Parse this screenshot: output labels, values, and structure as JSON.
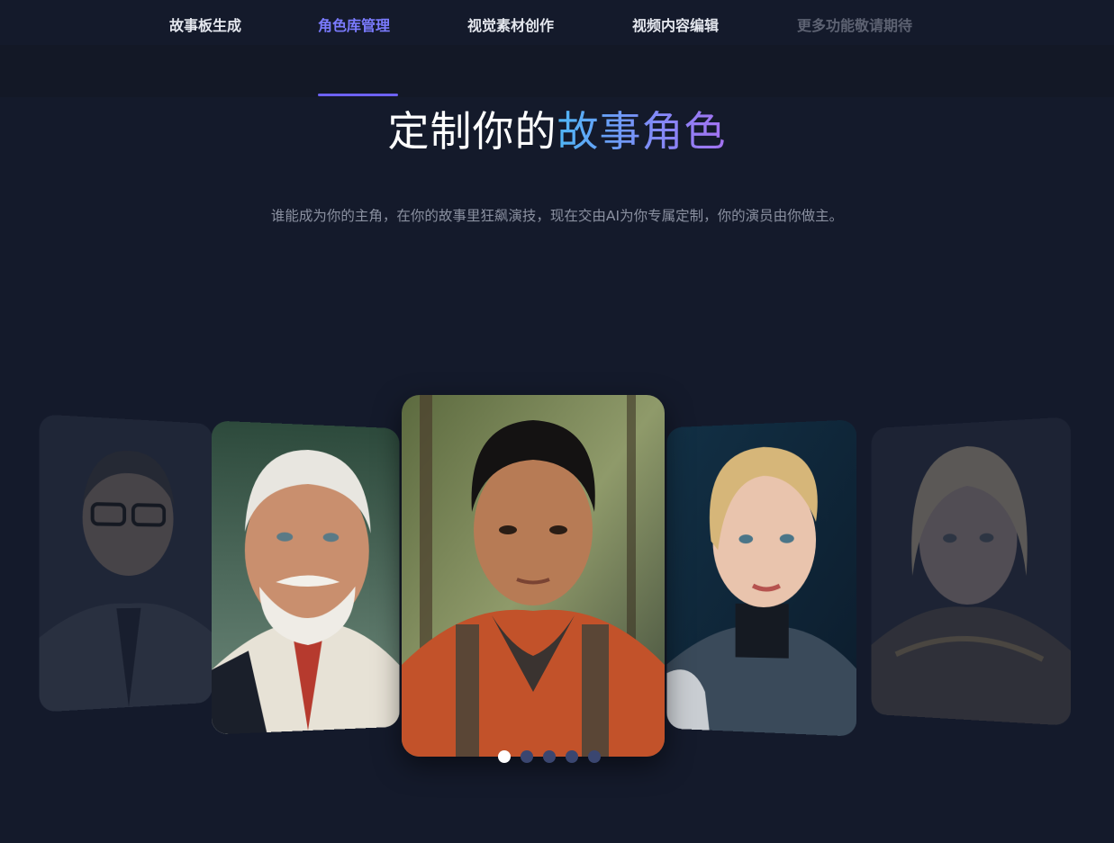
{
  "nav": {
    "items": [
      {
        "label": "故事板生成"
      },
      {
        "label": "角色库管理"
      },
      {
        "label": "视觉素材创作"
      },
      {
        "label": "视频内容编辑"
      },
      {
        "label": "更多功能敬请期待"
      }
    ],
    "active_index": 1
  },
  "hero": {
    "title_plain": "定制你的",
    "title_accent": "故事角色",
    "subtitle": "谁能成为你的主角，在你的故事里狂飙演技，现在交由AI为你专属定制，你的演员由你做主。"
  },
  "carousel": {
    "cards": [
      {
        "icon": "portrait-asian-man-glasses"
      },
      {
        "icon": "portrait-old-man-white-beard"
      },
      {
        "icon": "portrait-young-man-hiker"
      },
      {
        "icon": "portrait-blonde-woman-scifi-suit"
      },
      {
        "icon": "portrait-woman-armor"
      }
    ],
    "dot_count": 5,
    "active_dot": 0
  },
  "colors": {
    "background": "#141a2b",
    "nav_active": "#7b7bff",
    "accent_gradient_start": "#4fb6f6",
    "accent_gradient_end": "#a471f0"
  }
}
